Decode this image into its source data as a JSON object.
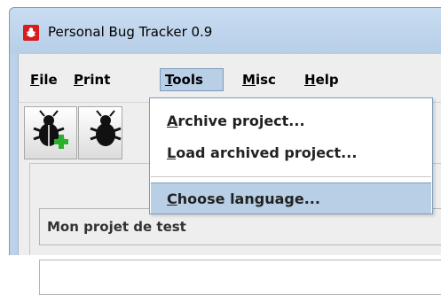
{
  "window": {
    "title": "Personal Bug Tracker 0.9"
  },
  "menubar": {
    "items": [
      {
        "mnemonic": "F",
        "rest": "ile"
      },
      {
        "mnemonic": "P",
        "rest": "rint"
      },
      {
        "mnemonic": "T",
        "rest": "ools"
      },
      {
        "mnemonic": "M",
        "rest": "isc"
      },
      {
        "mnemonic": "H",
        "rest": "elp"
      }
    ]
  },
  "tools_menu": {
    "items": [
      {
        "mnemonic": "A",
        "rest": "rchive project..."
      },
      {
        "mnemonic": "L",
        "rest": "oad archived project..."
      },
      {
        "mnemonic": "C",
        "rest": "hoose language..."
      }
    ]
  },
  "toolbar": {
    "buttons": [
      {
        "icon": "bug-add-icon"
      },
      {
        "icon": "bug-icon"
      }
    ]
  },
  "project": {
    "label": "Mon projet de test"
  },
  "colors": {
    "accent": "#b8cfe5",
    "titlebar": "#bcd2ea",
    "icon_red": "#d81b1b",
    "plus_green": "#2bb02b"
  }
}
